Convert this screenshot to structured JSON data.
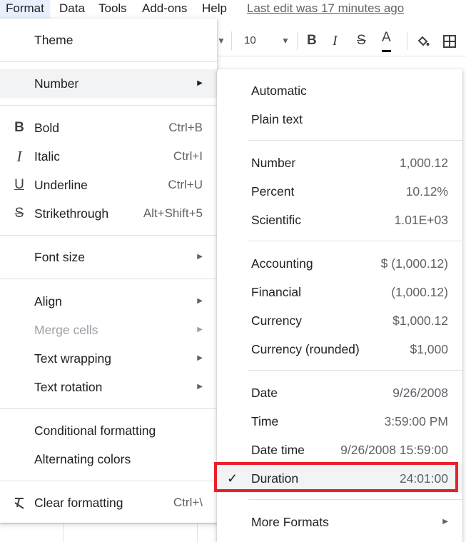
{
  "menubar": {
    "items": [
      "Format",
      "Data",
      "Tools",
      "Add-ons",
      "Help"
    ],
    "last_edit": "Last edit was 17 minutes ago"
  },
  "toolbar": {
    "font_size": "10",
    "bold": "B",
    "italic": "I",
    "strike": "S",
    "text_color": "A"
  },
  "format_menu": {
    "theme": "Theme",
    "number": "Number",
    "bold": {
      "label": "Bold",
      "shortcut": "Ctrl+B"
    },
    "italic": {
      "label": "Italic",
      "shortcut": "Ctrl+I"
    },
    "underline": {
      "label": "Underline",
      "shortcut": "Ctrl+U"
    },
    "strikethrough": {
      "label": "Strikethrough",
      "shortcut": "Alt+Shift+5"
    },
    "font_size": "Font size",
    "align": "Align",
    "merge_cells": "Merge cells",
    "text_wrapping": "Text wrapping",
    "text_rotation": "Text rotation",
    "conditional_formatting": "Conditional formatting",
    "alternating_colors": "Alternating colors",
    "clear_formatting": {
      "label": "Clear formatting",
      "shortcut": "Ctrl+\\"
    }
  },
  "number_submenu": {
    "automatic": "Automatic",
    "plain_text": "Plain text",
    "number": {
      "label": "Number",
      "example": "1,000.12"
    },
    "percent": {
      "label": "Percent",
      "example": "10.12%"
    },
    "scientific": {
      "label": "Scientific",
      "example": "1.01E+03"
    },
    "accounting": {
      "label": "Accounting",
      "example": "$ (1,000.12)"
    },
    "financial": {
      "label": "Financial",
      "example": "(1,000.12)"
    },
    "currency": {
      "label": "Currency",
      "example": "$1,000.12"
    },
    "currency_rounded": {
      "label": "Currency (rounded)",
      "example": "$1,000"
    },
    "date": {
      "label": "Date",
      "example": "9/26/2008"
    },
    "time": {
      "label": "Time",
      "example": "3:59:00 PM"
    },
    "date_time": {
      "label": "Date time",
      "example": "9/26/2008 15:59:00"
    },
    "duration": {
      "label": "Duration",
      "example": "24:01:00",
      "checked": true
    },
    "more_formats": "More Formats"
  },
  "colors": {
    "highlight_box": "#e8202a",
    "menu_hover": "#f1f3f4"
  }
}
